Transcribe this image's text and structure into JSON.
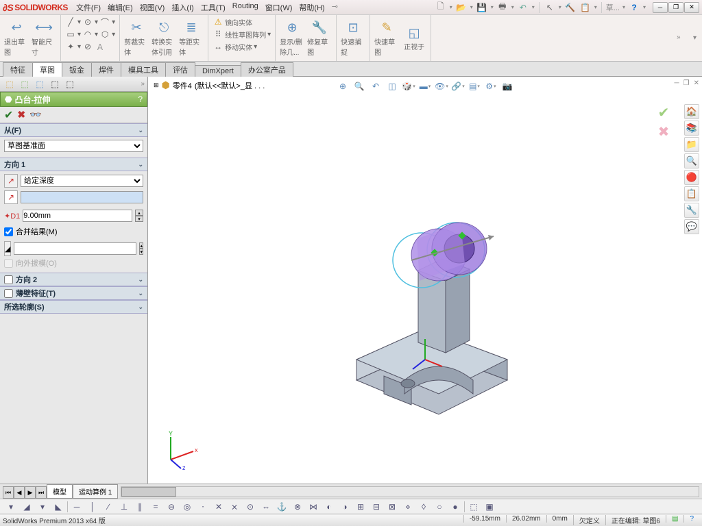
{
  "app": {
    "name": "SOLIDWORKS"
  },
  "menus": [
    "文件(F)",
    "编辑(E)",
    "视图(V)",
    "插入(I)",
    "工具(T)",
    "Routing",
    "窗口(W)",
    "帮助(H)"
  ],
  "titleSearch": "草...",
  "ribbon": {
    "exitSketch": "退出草图",
    "smartDim": "智能尺寸",
    "trim": "剪裁实体",
    "convert": "转换实体引用",
    "offset": "等距实体",
    "mirror": "镜向实体",
    "pattern": "线性草图阵列",
    "move": "移动实体",
    "showDel": "显示/删除几...",
    "repair": "修复草图",
    "quickSnap": "快速捕捉",
    "rapidSketch": "快速草图",
    "normalTo": "正视于"
  },
  "cmdTabs": [
    "特征",
    "草图",
    "钣金",
    "焊件",
    "模具工具",
    "评估",
    "DimXpert",
    "办公室产品"
  ],
  "activeCmdTab": 1,
  "breadcrumb": {
    "part": "零件4",
    "config": "(默认<<默认>_显 . . ."
  },
  "feature": {
    "title": "凸台-拉伸",
    "fromLabel": "从(F)",
    "fromOption": "草图基准面",
    "dir1Label": "方向 1",
    "endCondition": "给定深度",
    "depthValue": "9.00mm",
    "mergeLabel": "合并结果(M)",
    "draftLabel": "向外拔模(O)",
    "dir2Label": "方向 2",
    "thinLabel": "薄壁特征(T)",
    "contourLabel": "所选轮廓(S)"
  },
  "bottomTabs": [
    "模型",
    "运动算例 1"
  ],
  "status": {
    "product": "SolidWorks Premium 2013 x64 版",
    "coord1": "-59.15mm",
    "coord2": "26.02mm",
    "coord3": "0mm",
    "underdef": "欠定义",
    "editing": "正在编辑: 草图6"
  },
  "triad": {
    "x": "x",
    "y": "Y",
    "z": "z"
  }
}
